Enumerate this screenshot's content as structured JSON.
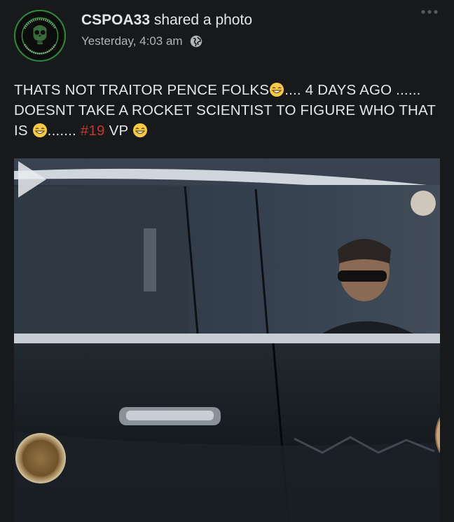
{
  "post": {
    "author": "CSPOA33",
    "action": "shared a photo",
    "timestamp": "Yesterday, 4:03 am",
    "privacy_icon": "globe-icon",
    "more_icon": "more-dots-icon"
  },
  "caption": {
    "part1": "THATS NOT TRAITOR PENCE FOLKS",
    "part2": ".... 4 DAYS AGO ...... DOESNT TAKE A ROCKET SCIENTIST TO FIGURE WHO THAT IS ",
    "part3": ".......",
    "hashtag": "#19",
    "part4": " VP ",
    "emoji": "grinning-face-emoji"
  },
  "media": {
    "type": "video",
    "play_icon": "play-icon"
  },
  "colors": {
    "background": "#18191a",
    "text": "#e4e6eb",
    "secondary_text": "#b0b3b8",
    "hashtag": "#c0392b",
    "avatar_ring": "#2e8b3a"
  }
}
